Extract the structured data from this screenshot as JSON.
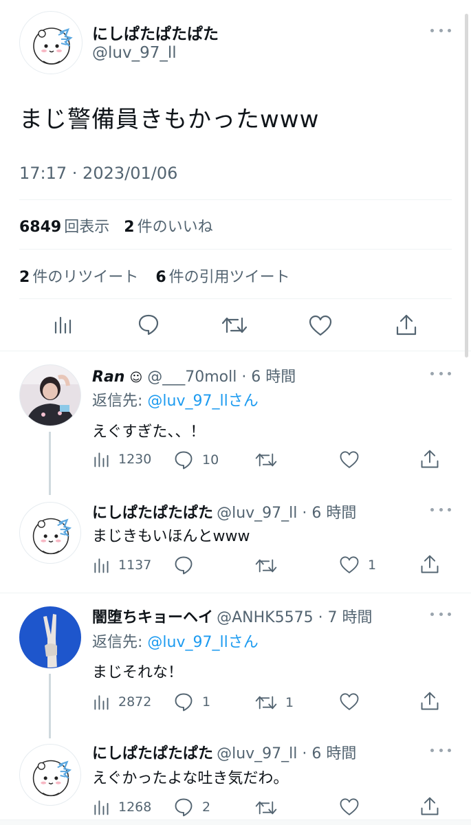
{
  "main_tweet": {
    "display_name": "にしぱたぱたぱた",
    "handle": "@luv_97_ll",
    "text": "まじ警備員きもかったwww",
    "timestamp": "17:17 · 2023/01/06",
    "views_count": "6849",
    "views_label": "回表示",
    "likes_count": "2",
    "likes_label": "件のいいね",
    "retweets_count": "2",
    "retweets_label": "件のリツイート",
    "quotes_count": "6",
    "quotes_label": "件の引用ツイート"
  },
  "replies": [
    {
      "display_name": "Ran",
      "name_emoji": "☺",
      "handle_time": "@___70moll · 6 時間",
      "reply_to_prefix": "返信先:",
      "reply_to_handle": "@luv_97_ll",
      "reply_to_suffix": "さん",
      "text": "えぐすぎた、、！",
      "views": "1230",
      "replies": "10",
      "retweets": "",
      "likes": ""
    },
    {
      "display_name": "にしぱたぱたぱた",
      "handle_time": "@luv_97_ll · 6 時間",
      "text": "まじきもいほんとwww",
      "views": "1137",
      "replies": "",
      "retweets": "",
      "likes": "1"
    },
    {
      "display_name": "闇堕ちキョーヘイ",
      "handle_time": "@ANHK5575 · 7 時間",
      "reply_to_prefix": "返信先:",
      "reply_to_handle": "@luv_97_ll",
      "reply_to_suffix": "さん",
      "text": "まじそれな！",
      "views": "2872",
      "replies": "1",
      "retweets": "1",
      "likes": ""
    },
    {
      "display_name": "にしぱたぱたぱた",
      "handle_time": "@luv_97_ll · 6 時間",
      "text": "えぐかったよな吐き気だわ。",
      "views": "1268",
      "replies": "2",
      "retweets": "",
      "likes": ""
    }
  ],
  "colors": {
    "link": "#1d9bf0",
    "muted": "#536471",
    "divider": "#eff3f4"
  }
}
